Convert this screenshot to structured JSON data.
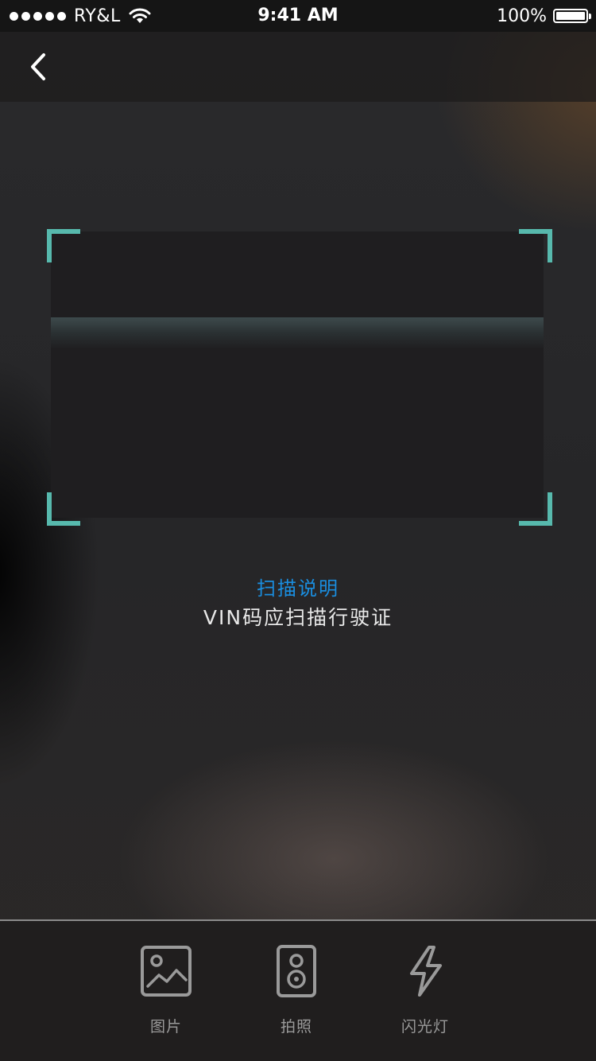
{
  "status_bar": {
    "carrier": "RY&L",
    "time": "9:41 AM",
    "battery": "100%"
  },
  "nav": {
    "back_icon": "chevron-left-icon"
  },
  "scan": {
    "accent_color": "#57b9ad",
    "instructions_title": "扫描说明",
    "instructions_text": "VIN码应扫描行驶证"
  },
  "toolbar": {
    "items": [
      {
        "label": "图片",
        "icon": "image-icon"
      },
      {
        "label": "拍照",
        "icon": "camera-icon"
      },
      {
        "label": "闪光灯",
        "icon": "flash-icon"
      }
    ]
  }
}
